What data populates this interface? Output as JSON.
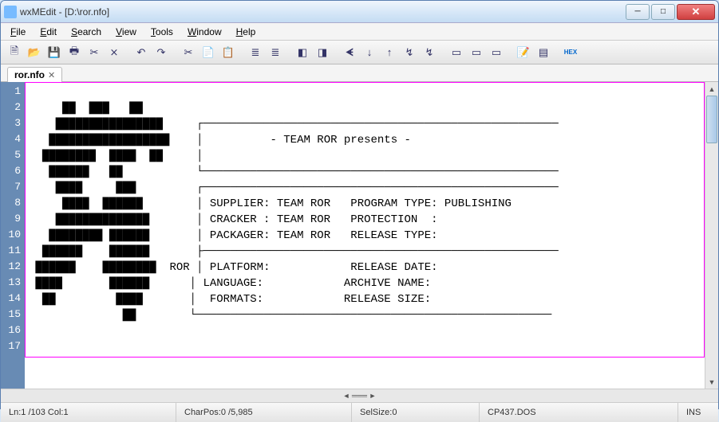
{
  "window": {
    "title": "wxMEdit - [D:\\ror.nfo]"
  },
  "menu": {
    "items": [
      "File",
      "Edit",
      "Search",
      "View",
      "Tools",
      "Window",
      "Help"
    ]
  },
  "toolbar": {
    "icons": [
      "🗎",
      "▤",
      "💾",
      "🖨",
      "✂",
      "⎌",
      "⎌",
      "⤺",
      "⤻",
      "✂",
      "📄",
      "📋",
      "≣",
      "≣",
      "◧",
      "◨",
      "ᗛ",
      "ᗚ",
      "↯",
      "↯",
      "↯",
      "▭",
      "▭",
      "▭",
      "📝",
      "▤",
      "HEX"
    ]
  },
  "tab": {
    "name": "ror.nfo",
    "close": "✕"
  },
  "lines": [
    "1",
    "2",
    "3",
    "4",
    "5",
    "6",
    "7",
    "8",
    "9",
    "10",
    "11",
    "12",
    "13",
    "14",
    "15",
    "16",
    "17"
  ],
  "text": {
    "l1": "",
    "l3_a": "┌─────────────────────────────────────────────────────",
    "l4_a": "│          - TEAM ROR presents -",
    "l5_a": "│",
    "l6_a": "└─────────────────────────────────────────────────────",
    "l7_a": "┌─────────────────────────────────────────────────────",
    "l8_a": "│ SUPPLIER: TEAM ROR   PROGRAM TYPE: PUBLISHING",
    "l9_a": "│ CRACKER : TEAM ROR   PROTECTION  :",
    "l10_a": "│ PACKAGER: TEAM ROR   RELEASE TYPE:",
    "l11_a": "├─────────────────────────────────────────────────────",
    "l12_a": "ROR │ PLATFORM:            RELEASE DATE:",
    "l13_a": "│ LANGUAGE:            ARCHIVE NAME:",
    "l14_a": "│  FORMATS:            RELEASE SIZE:",
    "l15_a": "└─────────────────────────────────────────────────────"
  },
  "status": {
    "pos": "Ln:1 /103 Col:1",
    "charpos": "CharPos:0 /5,985",
    "sel": "SelSize:0",
    "enc": "CP437.DOS",
    "ins": "INS"
  }
}
